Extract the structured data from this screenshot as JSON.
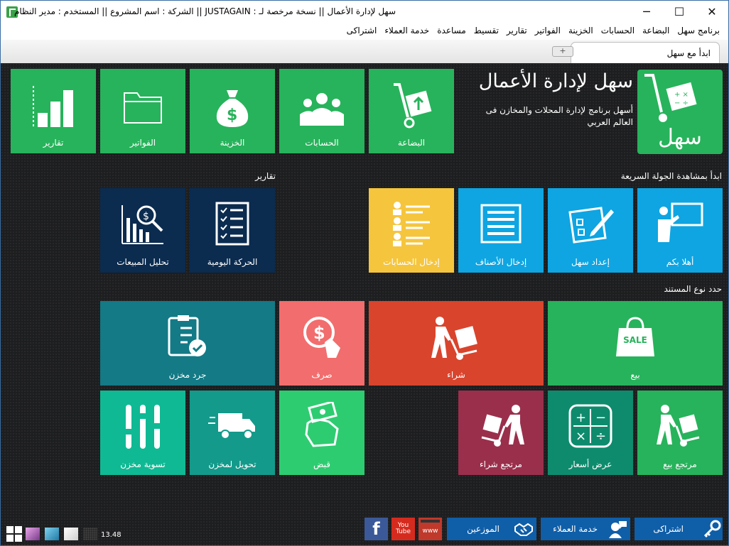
{
  "titlebar": {
    "title": "سهل لإدارة الأعمال  ||  نسخة مرخصة لـ : JUSTAGAIN  ||  الشركة : اسم المشروع  ||  المستخدم : مدير النظام",
    "minimize": "─",
    "maximize": "☐",
    "close": "✕"
  },
  "menu": [
    "برنامج سهل",
    "البضاعة",
    "الحسابات",
    "الخزينة",
    "الفواتير",
    "تقارير",
    "تقسيط",
    "مساعدة",
    "خدمة العملاء",
    "اشتراكى"
  ],
  "tabs": {
    "active": "ابدأ مع سهل",
    "add": "+"
  },
  "hero": {
    "title": "سهل لإدارة الأعمال",
    "subtitle": "أسهل برنامج لإدارة المحلات والمخازن فى العالم العربي",
    "logo_text": "سهل"
  },
  "top_tiles": [
    "البضاعة",
    "الحسابات",
    "الخزينة",
    "الفواتير",
    "تقارير"
  ],
  "sections": {
    "tour": "ابدأ بمشاهدة الجولة السريعة",
    "reports": "تقارير",
    "doc_type": "حدد نوع المستند"
  },
  "tour_tiles": [
    "أهلا بكم",
    "إعداد سهل",
    "إدخال الأصناف",
    "إدخال الحسابات"
  ],
  "report_tiles": [
    "الحركة اليومية",
    "تحليل المبيعات"
  ],
  "doc_tiles": {
    "sale": "بيع",
    "sale_badge": "SALE",
    "purchase": "شراء",
    "expense": "صرف",
    "inventory": "جرد مخزن",
    "sale_return": "مرتجع بيع",
    "quote": "عرض أسعار",
    "purchase_return": "مرتجع شراء",
    "receipt": "قبض",
    "transfer": "تحويل لمخزن",
    "adjust": "تسوية مخزن"
  },
  "bottom": {
    "subscription": "اشتراكى",
    "support": "خدمة العملاء",
    "distributors": "الموزعين",
    "www": "www",
    "youtube": "You Tube",
    "facebook": "f",
    "version": "13.48"
  },
  "colors": {
    "green": "#27b35b",
    "blue": "#0ea5e2",
    "yellow": "#f5c53d",
    "navy": "#0b2b4f",
    "teal": "#137a86",
    "coral": "#f26d6d",
    "red": "#d9442d",
    "maroon": "#9a2f4c",
    "bottom_blue": "#0f5ea8"
  }
}
